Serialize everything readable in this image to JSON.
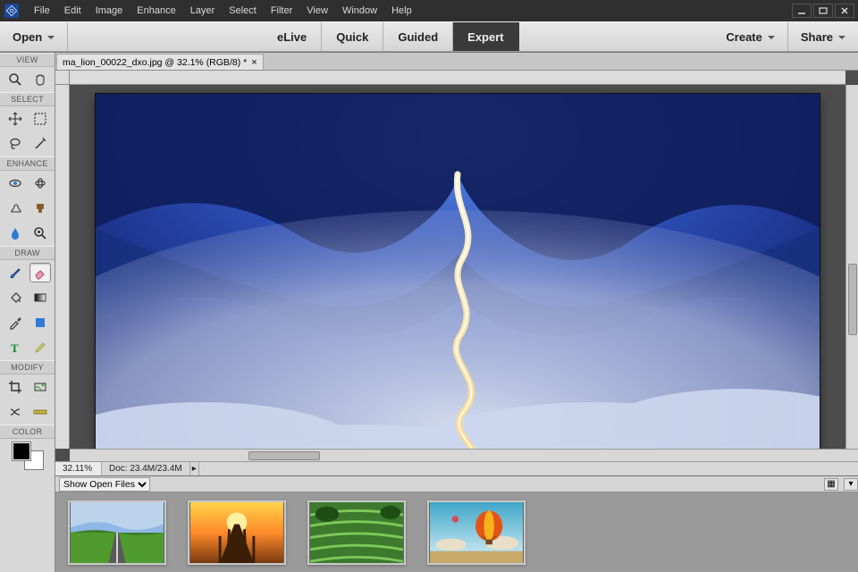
{
  "menubar": {
    "items": [
      "File",
      "Edit",
      "Image",
      "Enhance",
      "Layer",
      "Select",
      "Filter",
      "View",
      "Window",
      "Help"
    ]
  },
  "actionbar": {
    "open_label": "Open",
    "modes": [
      "eLive",
      "Quick",
      "Guided",
      "Expert"
    ],
    "active_mode_index": 3,
    "create_label": "Create",
    "share_label": "Share"
  },
  "palette_groups": {
    "view": "VIEW",
    "select": "SELECT",
    "enhance": "ENHANCE",
    "draw": "DRAW",
    "modify": "MODIFY",
    "color": "COLOR"
  },
  "document": {
    "tab_title": "ma_lion_00022_dxo.jpg @ 32.1% (RGB/8) *"
  },
  "status": {
    "zoom": "32.11%",
    "doc_size": "Doc: 23.4M/23.4M"
  },
  "footer": {
    "dropdown_label": "Show Open Files",
    "thumb_descriptions": [
      "green-field-road",
      "sunset-pier",
      "rice-terraces",
      "hot-air-balloon"
    ]
  },
  "colors": {
    "accent_dark": "#3a3a3a",
    "canvas_bg": "#4d4d4d"
  }
}
